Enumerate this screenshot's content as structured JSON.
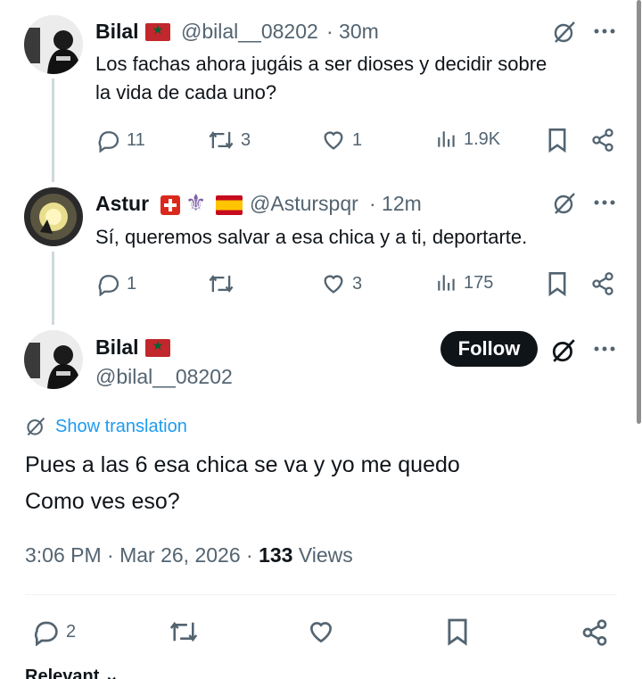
{
  "colors": {
    "text": "#0f1419",
    "muted": "#536471",
    "accent": "#1d9bf0",
    "follow_bg": "#0f1419"
  },
  "tweets": [
    {
      "name": "Bilal",
      "flag": "morocco-flag",
      "handle": "@bilal__08202",
      "time": "· 30m",
      "text_line1": "Los fachas ahora jugáis a ser dioses y decidir sobre",
      "text_line2": "la vida de cada uno?",
      "replies": "11",
      "reposts": "3",
      "likes": "1",
      "views": "1.9K"
    },
    {
      "name": "Astur",
      "flags": [
        "switzerland-flag",
        "fleur-de-lis",
        "spain-flag"
      ],
      "handle": "@Asturspqr",
      "time": "· 12m",
      "text_line1": "Sí, queremos salvar a esa chica y a ti, deportarte.",
      "replies": "1",
      "reposts": "",
      "likes": "3",
      "views": "175"
    }
  ],
  "main_tweet": {
    "name": "Bilal",
    "flag": "morocco-flag",
    "handle": "@bilal__08202",
    "follow_label": "Follow",
    "show_translation": "Show translation",
    "text_line1": "Pues a las 6 esa chica se va y yo me quedo",
    "text_line2": "Como ves eso?",
    "time": "3:06 PM · Mar 26, 2026 · ",
    "views_count": "133",
    "views_label": " Views",
    "replies": "2"
  },
  "sort_label": "Relevant"
}
